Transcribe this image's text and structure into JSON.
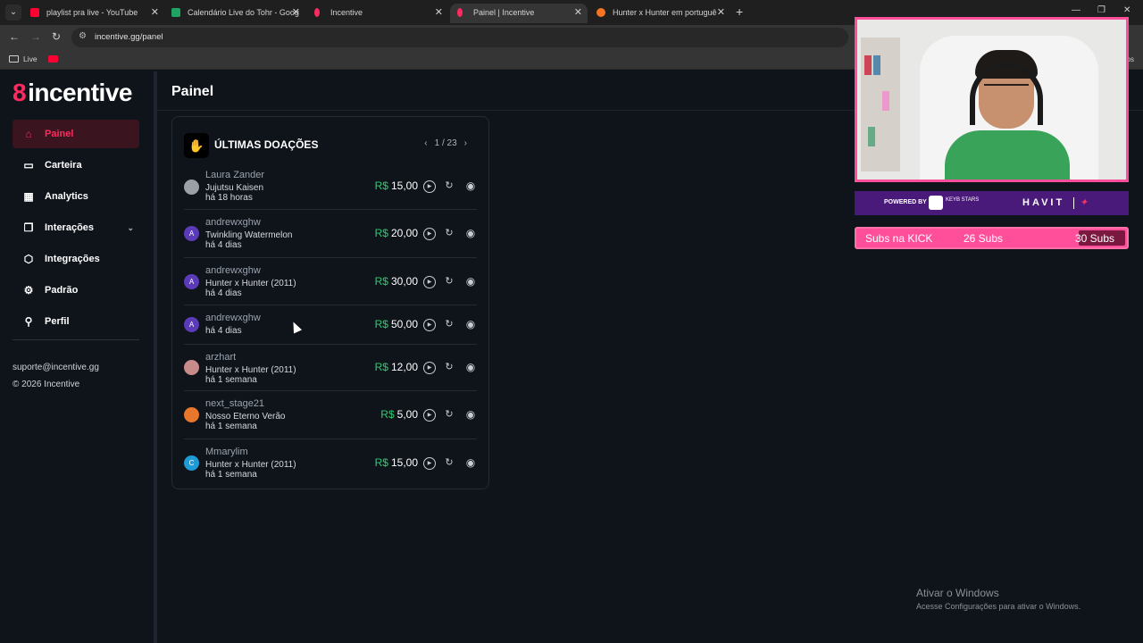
{
  "browser": {
    "tabs": [
      {
        "title": "playlist pra live - YouTube",
        "favicon_color": "#ff0033",
        "active": false
      },
      {
        "title": "Calendário Live do Tohr - Goog",
        "favicon_color": "#1fa463",
        "active": false
      },
      {
        "title": "Incentive",
        "favicon_color": "#ff2a5f",
        "active": false
      },
      {
        "title": "Painel | Incentive",
        "favicon_color": "#ff2a5f",
        "active": true
      },
      {
        "title": "Hunter x Hunter em portuguê",
        "favicon_color": "#f47521",
        "active": false
      }
    ],
    "new_tab": "+",
    "url": "incentive.gg/panel",
    "bookmark_folder": "Live",
    "bookmark_right": "os"
  },
  "app": {
    "logo": "incentive",
    "page_title": "Painel",
    "nav": [
      {
        "label": "Painel",
        "icon": "home-icon",
        "active": true
      },
      {
        "label": "Carteira",
        "icon": "wallet-icon",
        "active": false
      },
      {
        "label": "Analytics",
        "icon": "chart-icon",
        "active": false
      },
      {
        "label": "Interações",
        "icon": "interactions-icon",
        "active": false,
        "has_submenu": true
      },
      {
        "label": "Integrações",
        "icon": "cube-icon",
        "active": false
      },
      {
        "label": "Padrão",
        "icon": "gear-icon",
        "active": false
      },
      {
        "label": "Perfil",
        "icon": "user-icon",
        "active": false
      }
    ],
    "support_email": "suporte@incentive.gg",
    "copyright": "© 2026 Incentive",
    "accent": "#ff2a5f"
  },
  "donations": {
    "title": "ÚLTIMAS DOAÇÕES",
    "page": "1 / 23",
    "currency": "R$",
    "items": [
      {
        "name": "Laura Zander",
        "message": "Jujutsu Kaisen",
        "time": "há 18 horas",
        "amount": "15,00",
        "avatar": "",
        "avatar_color": "#9aa0a6"
      },
      {
        "name": "andrewxghw",
        "message": "Twinkling Watermelon",
        "time": "há 4 dias",
        "amount": "20,00",
        "avatar": "A",
        "avatar_color": "#5b3bb8"
      },
      {
        "name": "andrewxghw",
        "message": "Hunter x Hunter (2011)",
        "time": "há 4 dias",
        "amount": "30,00",
        "avatar": "A",
        "avatar_color": "#5b3bb8"
      },
      {
        "name": "andrewxghw",
        "message": "",
        "time": "há 4 dias",
        "amount": "50,00",
        "avatar": "A",
        "avatar_color": "#5b3bb8"
      },
      {
        "name": "arzhart",
        "message": "Hunter x Hunter (2011)",
        "time": "há 1 semana",
        "amount": "12,00",
        "avatar": "",
        "avatar_color": "#c98a8a"
      },
      {
        "name": "next_stage21",
        "message": "Nosso Eterno Verão",
        "time": "há 1 semana",
        "amount": "5,00",
        "avatar": "",
        "avatar_color": "#e8762b"
      },
      {
        "name": "Mmarylim",
        "message": "Hunter x Hunter (2011)",
        "time": "há 1 semana",
        "amount": "15,00",
        "avatar": "C",
        "avatar_color": "#1e9bd7"
      }
    ]
  },
  "overlay": {
    "powered_by": "POWERED BY",
    "sponsor_small": "KEYB STARS",
    "sponsor": "HAVIT",
    "subs_label": "Subs na KICK",
    "subs_current": "26 Subs",
    "subs_goal": "30 Subs",
    "subs_progress": 0.87
  },
  "windows": {
    "activate_title": "Ativar o Windows",
    "activate_sub": "Acesse Configurações para ativar o Windows."
  }
}
